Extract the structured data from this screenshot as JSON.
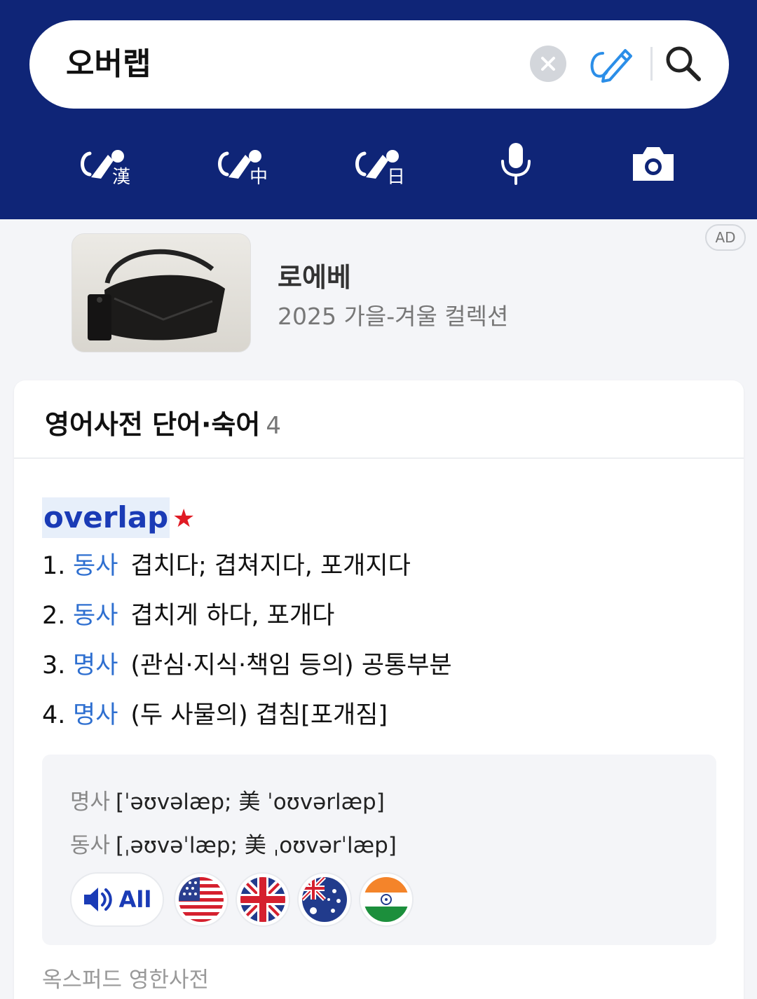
{
  "search": {
    "query": "오버랩"
  },
  "toolbar": {
    "icons": [
      "hanja-handwriting-icon",
      "chinese-handwriting-icon",
      "japanese-handwriting-icon",
      "microphone-icon",
      "camera-icon"
    ],
    "hanja_char": "漢",
    "chinese_char": "中",
    "japanese_char": "日"
  },
  "ad": {
    "title": "로에베",
    "subtitle": "2025 가을-겨울 컬렉션",
    "badge": "AD"
  },
  "dictionary": {
    "section_title": "영어사전 단어·숙어",
    "count": "4",
    "word": "overlap",
    "star": "★",
    "definitions": [
      {
        "num": "1.",
        "pos": "동사",
        "text": "겹치다; 겹쳐지다, 포개지다"
      },
      {
        "num": "2.",
        "pos": "동사",
        "text": "겹치게 하다, 포개다"
      },
      {
        "num": "3.",
        "pos": "명사",
        "text": "(관심·지식·책임 등의) 공통부분"
      },
      {
        "num": "4.",
        "pos": "명사",
        "text": "(두 사물의) 겹침[포개짐]"
      }
    ],
    "pronunciations": [
      {
        "pos": "명사",
        "text": "[ˈəʊvəlæp; 美 ˈoʊvərlæp]"
      },
      {
        "pos": "동사",
        "text": "[ˌəʊvəˈlæp; 美 ˌoʊvərˈlæp]"
      }
    ],
    "audio_all_label": "All",
    "flags": [
      "us-flag-icon",
      "uk-flag-icon",
      "australia-flag-icon",
      "india-flag-icon"
    ],
    "source": "옥스퍼드 영한사전"
  },
  "colors": {
    "header_bg": "#0f2577",
    "accent_blue": "#1a3bb6",
    "pos_blue": "#2e6fd0",
    "star_red": "#e01b24"
  }
}
